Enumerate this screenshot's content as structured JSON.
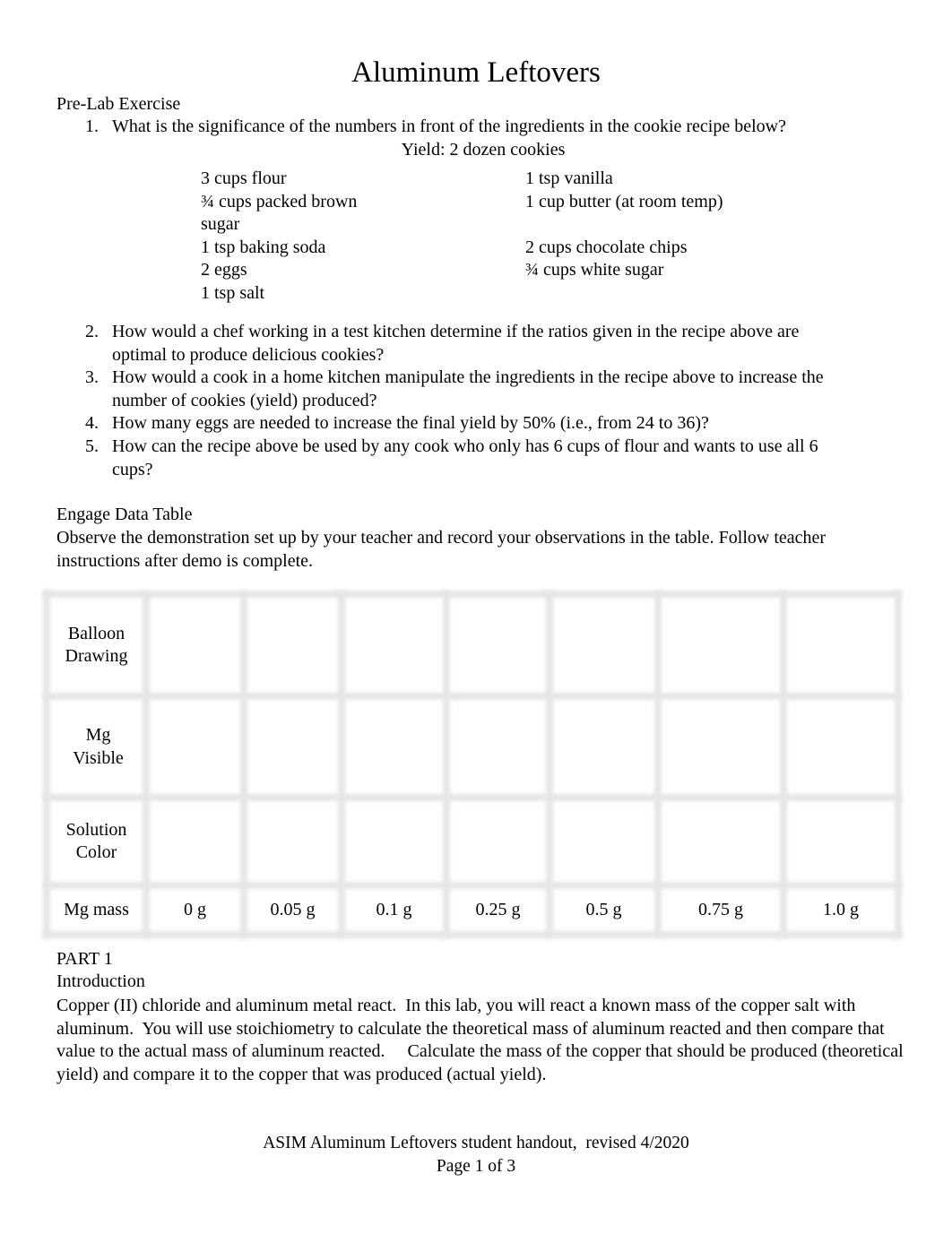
{
  "document": {
    "title": "Aluminum Leftovers",
    "prelab": {
      "heading": "Pre-Lab Exercise",
      "questions": [
        {
          "num": "1.",
          "text": "What is the significance of the numbers in front of the ingredients in the cookie recipe below?"
        },
        {
          "num": "2.",
          "text": "How would a chef working in a test kitchen determine if the ratios given in the recipe above are optimal to produce delicious cookies?"
        },
        {
          "num": "3.",
          "text": "How would a cook in a home kitchen manipulate the ingredients in the recipe above to increase the number of cookies (yield) produced?"
        },
        {
          "num": "4.",
          "text": "How many eggs are needed to increase the final yield by 50% (i.e., from 24 to 36)?"
        },
        {
          "num": "5.",
          "text": "How can the recipe above be used by any cook who only has 6 cups of flour and wants to use all 6 cups?"
        }
      ],
      "recipe": {
        "yield": "Yield: 2 dozen cookies",
        "column1": [
          "3 cups flour",
          "¾ cups packed brown sugar",
          "1 tsp baking soda",
          "2 eggs",
          "1 tsp salt"
        ],
        "column2": [
          "1 tsp vanilla",
          "1 cup butter (at room temp)",
          "2 cups chocolate chips",
          "¾ cups white sugar"
        ]
      }
    },
    "engage": {
      "heading": "Engage Data Table",
      "instructions": "Observe the demonstration set up by your teacher and record your observations in the table. Follow teacher instructions after demo is complete.",
      "table": {
        "row_labels": [
          "Balloon Drawing",
          "Mg Visible",
          "Solution Color",
          "Mg mass"
        ],
        "mg_mass_values": [
          "0 g",
          "0.05 g",
          "0.1 g",
          "0.25 g",
          "0.5 g",
          "0.75 g",
          "1.0 g"
        ]
      }
    },
    "part1": {
      "heading": "PART 1",
      "subheading": "Introduction",
      "paragraph": "Copper (II) chloride and aluminum metal react.  In this lab, you will react a known mass of the copper salt with aluminum.  You will use stoichiometry to calculate the theoretical mass of aluminum reacted and then compare that value to the actual mass of aluminum reacted.     Calculate the mass of the copper that should be produced (theoretical yield) and compare it to the copper that was produced (actual yield)."
    },
    "footer": {
      "line1": "ASIM Aluminum Leftovers student handout,  revised 4/2020",
      "line2": "Page 1 of 3"
    }
  }
}
